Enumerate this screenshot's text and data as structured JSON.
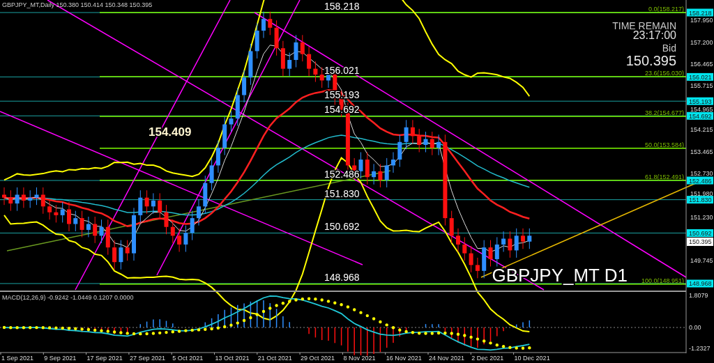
{
  "header": {
    "symbol": "GBPJPY_MT,Daily",
    "quote": "150.380 150.414 150.348 150.395"
  },
  "levels": [
    {
      "axis_label": "158.218",
      "chart_label": "158.218"
    },
    {
      "axis_label": "156.021",
      "chart_label": "156.021"
    },
    {
      "axis_label": "155.193",
      "chart_label": "155.193"
    },
    {
      "axis_label": "154.692",
      "chart_label": "154.692"
    },
    {
      "axis_label": "152.486",
      "chart_label": "152.486"
    },
    {
      "axis_label": "151.830",
      "chart_label": "151.830"
    },
    {
      "axis_label": "150.692",
      "chart_label": "150.692"
    },
    {
      "axis_label": "148.968",
      "chart_label": "148.968"
    }
  ],
  "fib_levels": [
    {
      "label": "0.0(158.217)"
    },
    {
      "label": "23.6(156.030)"
    },
    {
      "label": "38.2(154.677)"
    },
    {
      "label": "50.0(153.584)"
    },
    {
      "label": "61.8(152.491)"
    },
    {
      "label": "100.0(148.951)"
    }
  ],
  "marker_label": "154.409",
  "price_axis": {
    "ticks": [
      "157.950",
      "157.200",
      "156.465",
      "155.715",
      "154.965",
      "154.215",
      "153.465",
      "152.730",
      "151.980",
      "151.230",
      "149.745"
    ],
    "bid": "150.395"
  },
  "timer": {
    "title": "TIME REMAIN",
    "time": "23:17:00",
    "bid_label": "Bid",
    "bid": "150.395"
  },
  "symbol_label": "GBPJPY_MT D1",
  "macd": {
    "header": "MACD(12,26,9) -0.9242 -1.0449 0.1207 0.0000",
    "ticks": [
      "1.8079",
      "0.00",
      "-1.2327"
    ]
  },
  "dates": [
    "1 Sep 2021",
    "9 Sep 2021",
    "17 Sep 2021",
    "27 Sep 2021",
    "5 Oct 2021",
    "13 Oct 2021",
    "21 Oct 2021",
    "29 Oct 2021",
    "8 Nov 2021",
    "16 Nov 2021",
    "24 Nov 2021",
    "2 Dec 2021",
    "10 Dec 2021"
  ]
}
